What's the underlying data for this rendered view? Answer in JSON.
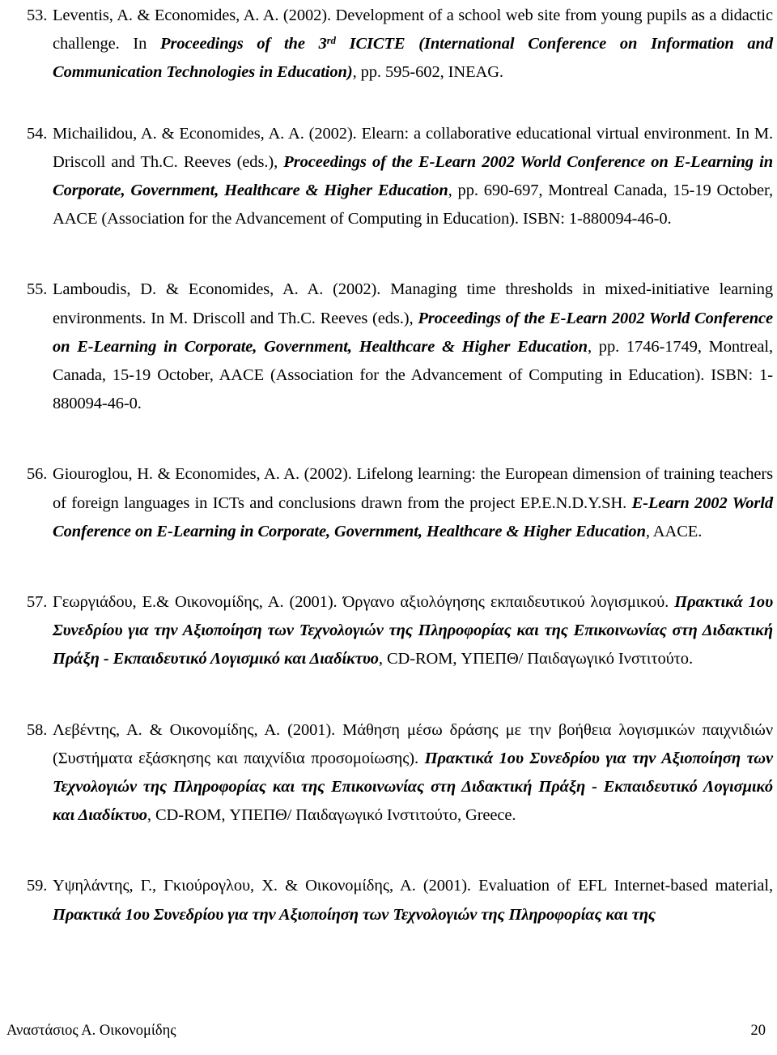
{
  "document": {
    "type": "bibliography-page",
    "language_mix": [
      "English",
      "Greek"
    ],
    "footer": {
      "author": "Αναστάσιος Α. Οικονομίδης",
      "page_number": "20"
    }
  },
  "references": [
    {
      "number": "53.",
      "segments": [
        {
          "style": "regular",
          "text": "Leventis, A.  & Economides, A. A. (2002). Development of a school web site from young pupils as a didactic challenge. In "
        },
        {
          "style": "bold-italic",
          "text": "Proceedings of the 3"
        },
        {
          "style": "bold-italic-superscript",
          "text": "rd"
        },
        {
          "style": "bold-italic",
          "text": " ICICTE (International Conference on Information and Communication Technologies in Education)"
        },
        {
          "style": "regular",
          "text": ", pp. 595-602, INEAG."
        }
      ]
    },
    {
      "number": "54.",
      "segments": [
        {
          "style": "regular",
          "text": "Michailidou, A. & Economides, A. A. (2002). Elearn: a collaborative educational virtual environment. In M. Driscoll and Th.C. Reeves (eds.), "
        },
        {
          "style": "bold-italic",
          "text": "Proceedings of the E-Learn 2002 World Conference on E-Learning in Corporate, Government, Healthcare & Higher Education"
        },
        {
          "style": "regular",
          "text": ", pp. 690-697, Montreal Canada, 15-19 October, AACE (Association for the Advancement of Computing in Education). ISBN: 1-880094-46-0."
        }
      ]
    },
    {
      "number": "55.",
      "segments": [
        {
          "style": "regular",
          "text": "Lamboudis, D. & Economides, A. A. (2002). Managing time thresholds in mixed-initiative learning environments. In M. Driscoll and Th.C. Reeves (eds.), "
        },
        {
          "style": "bold-italic",
          "text": "Proceedings of the E-Learn 2002 World Conference on E-Learning in Corporate, Government, Healthcare & Higher Education"
        },
        {
          "style": "regular",
          "text": ", pp. 1746-1749, Montreal, Canada, 15-19 October, AACE (Association for the Advancement of Computing in Education). ISBN: 1-880094-46-0."
        }
      ]
    },
    {
      "number": "56.",
      "segments": [
        {
          "style": "regular",
          "text": "Giouroglou, H. & Economides, A. A. (2002). Lifelong learning: the European dimension of training teachers of foreign languages in ICTs and conclusions drawn from the project EP.E.N.D.Y.SH. "
        },
        {
          "style": "bold-italic",
          "text": "E-Learn 2002 World Conference on E-Learning in Corporate, Government, Healthcare & Higher Education"
        },
        {
          "style": "regular",
          "text": ", AACE."
        }
      ]
    },
    {
      "number": "57.",
      "segments": [
        {
          "style": "regular",
          "text": "Γεωργιάδου, Ε.& Οικονομίδης, Α. (2001). Όργανο αξιολόγησης εκπαιδευτικού λογισμικού. "
        },
        {
          "style": "bold-italic",
          "text": "Πρακτικά 1ου Συνεδρίου για την Αξιοποίηση των Τεχνολογιών της Πληροφορίας και της Επικοινωνίας στη Διδακτική Πράξη - Εκπαιδευτικό Λογισμικό και Διαδίκτυο"
        },
        {
          "style": "regular",
          "text": ", CD-ROM, ΥΠΕΠΘ/ Παιδαγωγικό Ινστιτούτο."
        }
      ]
    },
    {
      "number": "58.",
      "segments": [
        {
          "style": "regular",
          "text": "Λεβέντης, Α. & Οικονομίδης, Α. (2001). Μάθηση μέσω δράσης με την βοήθεια λογισμικών παιχνιδιών (Συστήματα εξάσκησης και παιχνίδια προσομοίωσης). "
        },
        {
          "style": "bold-italic",
          "text": "Πρακτικά 1ου Συνεδρίου για την Αξιοποίηση των Τεχνολογιών της Πληροφορίας και της Επικοινωνίας στη Διδακτική Πράξη - Εκπαιδευτικό Λογισμικό και Διαδίκτυο"
        },
        {
          "style": "regular",
          "text": ", CD-ROM, ΥΠΕΠΘ/ Παιδαγωγικό Ινστιτούτο, Greece."
        }
      ]
    },
    {
      "number": "59.",
      "segments": [
        {
          "style": "regular",
          "text": "Υψηλάντης, Γ., Γκιούρογλου, Χ. & Οικονομίδης, Α. (2001). Evaluation of EFL Internet-based material, "
        },
        {
          "style": "bold-italic",
          "text": "Πρακτικά 1ου Συνεδρίου για την Αξιοποίηση των Τεχνολογιών της Πληροφορίας και της "
        }
      ]
    }
  ]
}
